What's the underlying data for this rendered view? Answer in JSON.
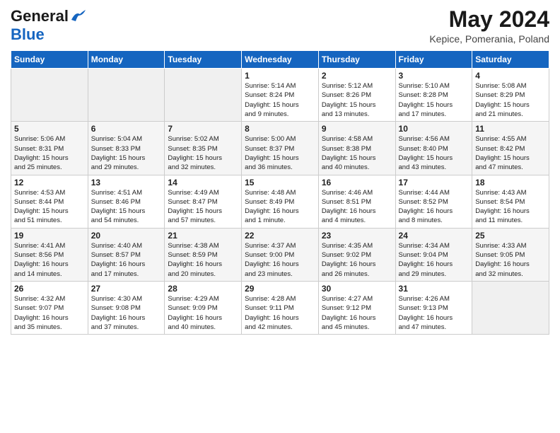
{
  "header": {
    "logo_line1": "General",
    "logo_line2": "Blue",
    "title": "May 2024",
    "subtitle": "Kepice, Pomerania, Poland"
  },
  "days_of_week": [
    "Sunday",
    "Monday",
    "Tuesday",
    "Wednesday",
    "Thursday",
    "Friday",
    "Saturday"
  ],
  "weeks": [
    [
      {
        "day": "",
        "info": ""
      },
      {
        "day": "",
        "info": ""
      },
      {
        "day": "",
        "info": ""
      },
      {
        "day": "1",
        "info": "Sunrise: 5:14 AM\nSunset: 8:24 PM\nDaylight: 15 hours\nand 9 minutes."
      },
      {
        "day": "2",
        "info": "Sunrise: 5:12 AM\nSunset: 8:26 PM\nDaylight: 15 hours\nand 13 minutes."
      },
      {
        "day": "3",
        "info": "Sunrise: 5:10 AM\nSunset: 8:28 PM\nDaylight: 15 hours\nand 17 minutes."
      },
      {
        "day": "4",
        "info": "Sunrise: 5:08 AM\nSunset: 8:29 PM\nDaylight: 15 hours\nand 21 minutes."
      }
    ],
    [
      {
        "day": "5",
        "info": "Sunrise: 5:06 AM\nSunset: 8:31 PM\nDaylight: 15 hours\nand 25 minutes."
      },
      {
        "day": "6",
        "info": "Sunrise: 5:04 AM\nSunset: 8:33 PM\nDaylight: 15 hours\nand 29 minutes."
      },
      {
        "day": "7",
        "info": "Sunrise: 5:02 AM\nSunset: 8:35 PM\nDaylight: 15 hours\nand 32 minutes."
      },
      {
        "day": "8",
        "info": "Sunrise: 5:00 AM\nSunset: 8:37 PM\nDaylight: 15 hours\nand 36 minutes."
      },
      {
        "day": "9",
        "info": "Sunrise: 4:58 AM\nSunset: 8:38 PM\nDaylight: 15 hours\nand 40 minutes."
      },
      {
        "day": "10",
        "info": "Sunrise: 4:56 AM\nSunset: 8:40 PM\nDaylight: 15 hours\nand 43 minutes."
      },
      {
        "day": "11",
        "info": "Sunrise: 4:55 AM\nSunset: 8:42 PM\nDaylight: 15 hours\nand 47 minutes."
      }
    ],
    [
      {
        "day": "12",
        "info": "Sunrise: 4:53 AM\nSunset: 8:44 PM\nDaylight: 15 hours\nand 51 minutes."
      },
      {
        "day": "13",
        "info": "Sunrise: 4:51 AM\nSunset: 8:46 PM\nDaylight: 15 hours\nand 54 minutes."
      },
      {
        "day": "14",
        "info": "Sunrise: 4:49 AM\nSunset: 8:47 PM\nDaylight: 15 hours\nand 57 minutes."
      },
      {
        "day": "15",
        "info": "Sunrise: 4:48 AM\nSunset: 8:49 PM\nDaylight: 16 hours\nand 1 minute."
      },
      {
        "day": "16",
        "info": "Sunrise: 4:46 AM\nSunset: 8:51 PM\nDaylight: 16 hours\nand 4 minutes."
      },
      {
        "day": "17",
        "info": "Sunrise: 4:44 AM\nSunset: 8:52 PM\nDaylight: 16 hours\nand 8 minutes."
      },
      {
        "day": "18",
        "info": "Sunrise: 4:43 AM\nSunset: 8:54 PM\nDaylight: 16 hours\nand 11 minutes."
      }
    ],
    [
      {
        "day": "19",
        "info": "Sunrise: 4:41 AM\nSunset: 8:56 PM\nDaylight: 16 hours\nand 14 minutes."
      },
      {
        "day": "20",
        "info": "Sunrise: 4:40 AM\nSunset: 8:57 PM\nDaylight: 16 hours\nand 17 minutes."
      },
      {
        "day": "21",
        "info": "Sunrise: 4:38 AM\nSunset: 8:59 PM\nDaylight: 16 hours\nand 20 minutes."
      },
      {
        "day": "22",
        "info": "Sunrise: 4:37 AM\nSunset: 9:00 PM\nDaylight: 16 hours\nand 23 minutes."
      },
      {
        "day": "23",
        "info": "Sunrise: 4:35 AM\nSunset: 9:02 PM\nDaylight: 16 hours\nand 26 minutes."
      },
      {
        "day": "24",
        "info": "Sunrise: 4:34 AM\nSunset: 9:04 PM\nDaylight: 16 hours\nand 29 minutes."
      },
      {
        "day": "25",
        "info": "Sunrise: 4:33 AM\nSunset: 9:05 PM\nDaylight: 16 hours\nand 32 minutes."
      }
    ],
    [
      {
        "day": "26",
        "info": "Sunrise: 4:32 AM\nSunset: 9:07 PM\nDaylight: 16 hours\nand 35 minutes."
      },
      {
        "day": "27",
        "info": "Sunrise: 4:30 AM\nSunset: 9:08 PM\nDaylight: 16 hours\nand 37 minutes."
      },
      {
        "day": "28",
        "info": "Sunrise: 4:29 AM\nSunset: 9:09 PM\nDaylight: 16 hours\nand 40 minutes."
      },
      {
        "day": "29",
        "info": "Sunrise: 4:28 AM\nSunset: 9:11 PM\nDaylight: 16 hours\nand 42 minutes."
      },
      {
        "day": "30",
        "info": "Sunrise: 4:27 AM\nSunset: 9:12 PM\nDaylight: 16 hours\nand 45 minutes."
      },
      {
        "day": "31",
        "info": "Sunrise: 4:26 AM\nSunset: 9:13 PM\nDaylight: 16 hours\nand 47 minutes."
      },
      {
        "day": "",
        "info": ""
      }
    ]
  ]
}
